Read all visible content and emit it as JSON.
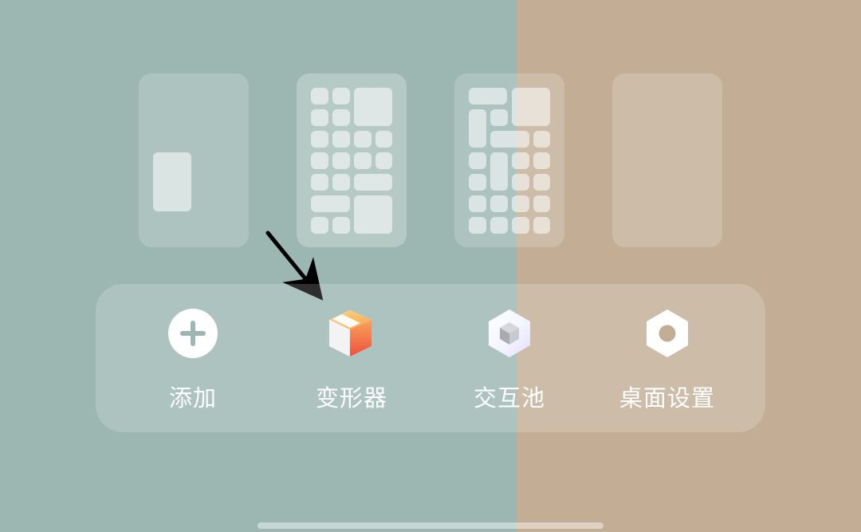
{
  "actions": {
    "add": {
      "label": "添加",
      "icon": "plus-circle-icon"
    },
    "transformer": {
      "label": "变形器",
      "icon": "cube-transformer-icon"
    },
    "pool": {
      "label": "交互池",
      "icon": "cube-pool-icon"
    },
    "settings": {
      "label": "桌面设置",
      "icon": "gear-hexagon-icon"
    }
  },
  "colors": {
    "left_background": "#9cb6b1",
    "right_background": "#c3ae95",
    "text": "#ffffff",
    "arrow": "#000000"
  }
}
